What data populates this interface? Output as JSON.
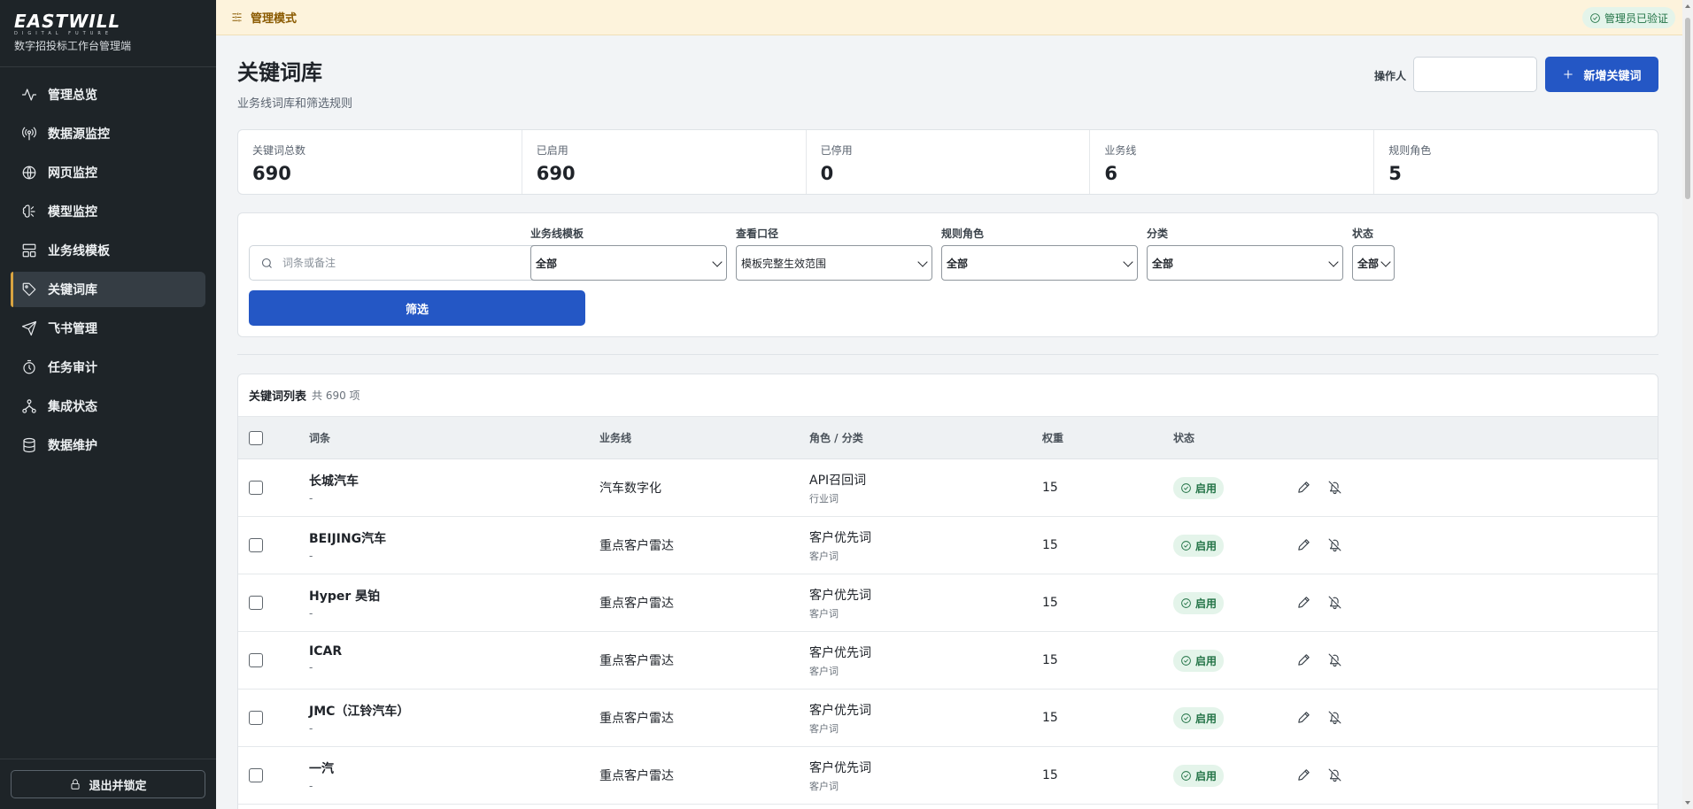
{
  "brand": {
    "logo": "EASTWILL",
    "tagline": "DIGITAL FUTURE",
    "subtitle": "数字招投标工作台管理端"
  },
  "sidebar": {
    "items": [
      {
        "label": "管理总览",
        "icon": "activity-icon"
      },
      {
        "label": "数据源监控",
        "icon": "broadcast-icon"
      },
      {
        "label": "网页监控",
        "icon": "globe-icon"
      },
      {
        "label": "模型监控",
        "icon": "brain-icon"
      },
      {
        "label": "业务线模板",
        "icon": "template-icon"
      },
      {
        "label": "关键词库",
        "icon": "tag-icon",
        "active": true
      },
      {
        "label": "飞书管理",
        "icon": "send-icon"
      },
      {
        "label": "任务审计",
        "icon": "timer-icon"
      },
      {
        "label": "集成状态",
        "icon": "network-icon"
      },
      {
        "label": "数据维护",
        "icon": "database-icon"
      }
    ],
    "logout_label": "退出并锁定"
  },
  "banner": {
    "mode_label": "管理模式",
    "verified_label": "管理员已验证",
    "bg_color": "#fdf3dc",
    "verified_color": "#227346"
  },
  "page": {
    "title": "关键词库",
    "subtitle": "业务线词库和筛选规则",
    "operator_label": "操作人",
    "operator_value": "",
    "add_button": "新增关键词",
    "accent_color": "#2457c5"
  },
  "stats": [
    {
      "label": "关键词总数",
      "value": "690"
    },
    {
      "label": "已启用",
      "value": "690"
    },
    {
      "label": "已停用",
      "value": "0"
    },
    {
      "label": "业务线",
      "value": "6"
    },
    {
      "label": "规则角色",
      "value": "5"
    }
  ],
  "filters": {
    "search_placeholder": "词条或备注",
    "search_value": "",
    "template_label": "业务线模板",
    "template_value": "全部",
    "scope_label": "查看口径",
    "scope_value": "模板完整生效范围",
    "role_label": "规则角色",
    "role_value": "全部",
    "category_label": "分类",
    "category_value": "全部",
    "status_label": "状态",
    "status_value": "全部",
    "submit_label": "筛选"
  },
  "table": {
    "title": "关键词列表",
    "count": "共 690 项",
    "headers": {
      "term": "词条",
      "business": "业务线",
      "role": "角色 / 分类",
      "weight": "权重",
      "status": "状态"
    },
    "rows": [
      {
        "term": "长城汽车",
        "note": "-",
        "business": "汽车数字化",
        "role": "API召回词",
        "category": "行业词",
        "weight": "15",
        "status": "启用"
      },
      {
        "term": "BEIJING汽车",
        "note": "-",
        "business": "重点客户雷达",
        "role": "客户优先词",
        "category": "客户词",
        "weight": "15",
        "status": "启用"
      },
      {
        "term": "Hyper 昊铂",
        "note": "-",
        "business": "重点客户雷达",
        "role": "客户优先词",
        "category": "客户词",
        "weight": "15",
        "status": "启用"
      },
      {
        "term": "ICAR",
        "note": "-",
        "business": "重点客户雷达",
        "role": "客户优先词",
        "category": "客户词",
        "weight": "15",
        "status": "启用"
      },
      {
        "term": "JMC（江铃汽车）",
        "note": "-",
        "business": "重点客户雷达",
        "role": "客户优先词",
        "category": "客户词",
        "weight": "15",
        "status": "启用"
      },
      {
        "term": "一汽",
        "note": "-",
        "business": "重点客户雷达",
        "role": "客户优先词",
        "category": "客户词",
        "weight": "15",
        "status": "启用"
      }
    ]
  }
}
